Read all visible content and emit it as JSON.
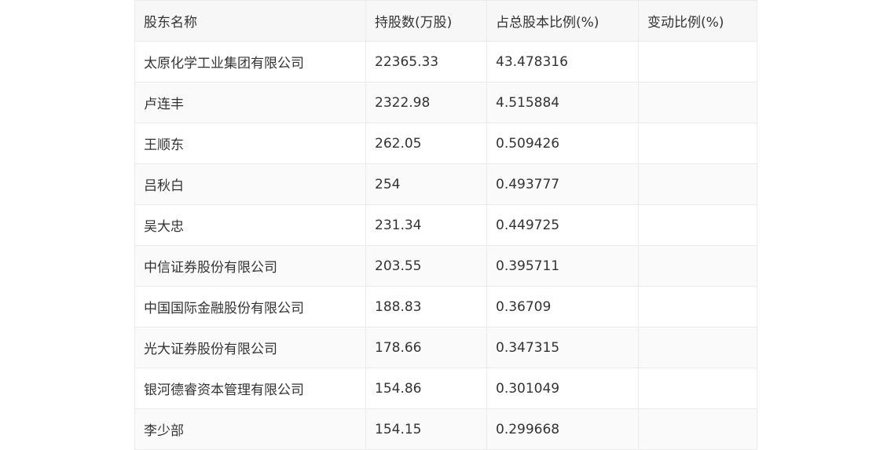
{
  "table": {
    "headers": [
      "股东名称",
      "持股数(万股)",
      "占总股本比例(%)",
      "变动比例(%)"
    ],
    "rows": [
      [
        "太原化学工业集团有限公司",
        "22365.33",
        "43.478316",
        ""
      ],
      [
        "卢连丰",
        "2322.98",
        "4.515884",
        ""
      ],
      [
        "王顺东",
        "262.05",
        "0.509426",
        ""
      ],
      [
        "吕秋白",
        "254",
        "0.493777",
        ""
      ],
      [
        "吴大忠",
        "231.34",
        "0.449725",
        ""
      ],
      [
        "中信证券股份有限公司",
        "203.55",
        "0.395711",
        ""
      ],
      [
        "中国国际金融股份有限公司",
        "188.83",
        "0.36709",
        ""
      ],
      [
        "光大证券股份有限公司",
        "178.66",
        "0.347315",
        ""
      ],
      [
        "银河德睿资本管理有限公司",
        "154.86",
        "0.301049",
        ""
      ],
      [
        "李少部",
        "154.15",
        "0.299668",
        ""
      ]
    ]
  }
}
